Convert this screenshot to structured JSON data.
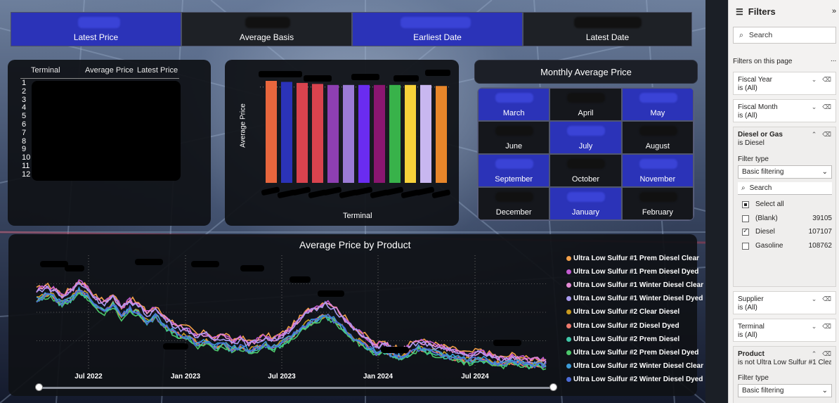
{
  "kpis": [
    {
      "label": "Latest Price",
      "style": "blue"
    },
    {
      "label": "Average Basis",
      "style": "dark"
    },
    {
      "label": "Earliest Date",
      "style": "blue"
    },
    {
      "label": "Latest Date",
      "style": "dark"
    }
  ],
  "terminal_table": {
    "headers": [
      "Terminal",
      "Average Price",
      "Latest Price"
    ],
    "row_numbers": [
      "1",
      "2",
      "3",
      "4",
      "5",
      "6",
      "7",
      "8",
      "9",
      "10",
      "11",
      "12"
    ]
  },
  "bar_chart": {
    "ylabel": "Average Price",
    "xlabel": "Terminal"
  },
  "monthly": {
    "title": "Monthly Average Price",
    "months": [
      {
        "name": "March",
        "style": "blue"
      },
      {
        "name": "April",
        "style": "dark"
      },
      {
        "name": "May",
        "style": "blue"
      },
      {
        "name": "June",
        "style": "dark"
      },
      {
        "name": "July",
        "style": "blue"
      },
      {
        "name": "August",
        "style": "dark"
      },
      {
        "name": "September",
        "style": "blue"
      },
      {
        "name": "October",
        "style": "dark"
      },
      {
        "name": "November",
        "style": "blue"
      },
      {
        "name": "December",
        "style": "dark"
      },
      {
        "name": "January",
        "style": "blue"
      },
      {
        "name": "February",
        "style": "dark"
      }
    ]
  },
  "line_chart": {
    "title": "Average Price by Product",
    "x_ticks": [
      "Jul 2022",
      "Jan 2023",
      "Jul 2023",
      "Jan 2024",
      "Jul 2024"
    ]
  },
  "chart_data": [
    {
      "type": "bar",
      "xlabel": "Terminal",
      "ylabel": "Average Price",
      "bars": 12,
      "colors": [
        "#e8663d",
        "#2b33b8",
        "#d9434e",
        "#d9434e",
        "#8e3fb2",
        "#9b7bd6",
        "#6a2cf0",
        "#8a1670",
        "#38b24a",
        "#f7d23a",
        "#c8b7f0",
        "#e8862a"
      ],
      "relative_heights": [
        1.0,
        0.99,
        0.98,
        0.97,
        0.96,
        0.96,
        0.96,
        0.96,
        0.96,
        0.96,
        0.96,
        0.95
      ]
    },
    {
      "type": "line",
      "title": "Average Price by Product",
      "x_ticks": [
        "Jul 2022",
        "Jan 2023",
        "Jul 2023",
        "Jan 2024",
        "Jul 2024"
      ],
      "series_names": [
        "Ultra Low Sulfur #1 Prem Diesel Clear",
        "Ultra Low Sulfur #1 Prem Diesel Dyed",
        "Ultra Low Sulfur #1 Winter Diesel Clear",
        "Ultra Low Sulfur #1 Winter Diesel Dyed",
        "Ultra Low Sulfur #2 Clear Diesel",
        "Ultra Low Sulfur #2 Diesel Dyed",
        "Ultra Low Sulfur #2 Prem Diesel",
        "Ultra Low Sulfur #2 Prem Diesel Dyed",
        "Ultra Low Sulfur #2 Winter Diesel Clear",
        "Ultra Low Sulfur #2 Winter Diesel Dyed"
      ],
      "series_colors": [
        "#f4a04a",
        "#c45bd1",
        "#e58bd6",
        "#a99bf0",
        "#c99a1e",
        "#ef7a6e",
        "#3fc6a8",
        "#4cc76a",
        "#3c9bd8",
        "#4b6bd6"
      ],
      "upper_band": [
        0.7,
        0.74,
        0.72,
        0.66,
        0.7,
        0.78,
        0.73,
        0.64,
        0.6,
        0.66,
        0.55,
        0.62,
        0.58,
        0.5,
        0.55,
        0.47,
        0.42,
        0.38,
        0.36,
        0.3,
        0.33,
        0.28,
        0.31,
        0.26,
        0.28,
        0.24,
        0.27,
        0.3,
        0.28,
        0.32,
        0.38,
        0.45,
        0.52,
        0.55,
        0.6,
        0.56,
        0.48,
        0.4,
        0.34,
        0.28,
        0.22,
        0.24,
        0.2,
        0.18,
        0.22,
        0.26,
        0.24,
        0.22,
        0.2,
        0.18,
        0.16,
        0.14,
        0.17,
        0.15,
        0.12,
        0.1,
        0.13,
        0.11,
        0.09,
        0.1,
        0.08
      ],
      "lower_band": [
        0.62,
        0.66,
        0.64,
        0.58,
        0.62,
        0.7,
        0.65,
        0.56,
        0.52,
        0.58,
        0.47,
        0.54,
        0.5,
        0.42,
        0.47,
        0.39,
        0.34,
        0.3,
        0.28,
        0.22,
        0.25,
        0.2,
        0.23,
        0.18,
        0.2,
        0.17,
        0.19,
        0.22,
        0.2,
        0.24,
        0.29,
        0.35,
        0.41,
        0.44,
        0.48,
        0.44,
        0.37,
        0.3,
        0.25,
        0.2,
        0.15,
        0.17,
        0.13,
        0.11,
        0.15,
        0.19,
        0.17,
        0.15,
        0.13,
        0.11,
        0.09,
        0.08,
        0.1,
        0.09,
        0.06,
        0.05,
        0.07,
        0.06,
        0.04,
        0.05,
        0.04
      ]
    }
  ],
  "filters": {
    "title": "Filters",
    "search_placeholder": "Search",
    "section_label": "Filters on this page",
    "more": "...",
    "cards": [
      {
        "name": "Fiscal Year",
        "value": "is (All)"
      },
      {
        "name": "Fiscal Month",
        "value": "is (All)"
      }
    ],
    "diesel": {
      "name": "Diesel or Gas",
      "value": "is Diesel",
      "filter_type_label": "Filter type",
      "filter_type": "Basic filtering",
      "search": "Search",
      "options": [
        {
          "label": "Select all",
          "count": "",
          "state": "partial"
        },
        {
          "label": "(Blank)",
          "count": "39105",
          "state": "off"
        },
        {
          "label": "Diesel",
          "count": "107107",
          "state": "on"
        },
        {
          "label": "Gasoline",
          "count": "108762",
          "state": "off"
        }
      ]
    },
    "cards2": [
      {
        "name": "Supplier",
        "value": "is (All)"
      },
      {
        "name": "Terminal",
        "value": "is (All)"
      }
    ],
    "product": {
      "name": "Product",
      "value": "is not Ultra Low Sulfur #1 Clea...",
      "filter_type_label": "Filter type",
      "filter_type": "Basic filtering"
    }
  }
}
